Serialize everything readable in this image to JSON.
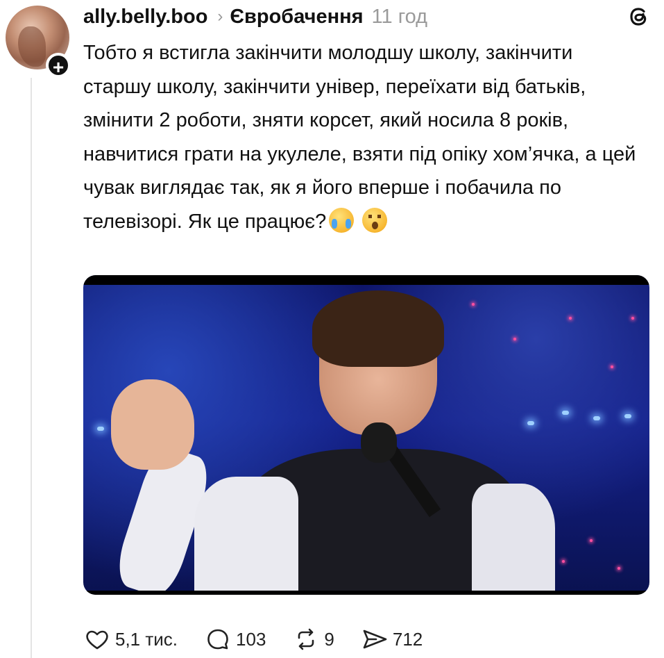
{
  "post": {
    "username": "ally.belly.boo",
    "topic": "Євробачення",
    "time": "11 год",
    "text": "Тобто я встигла закінчити молодшу школу, закінчити старшу школу, закінчити універ, переїхати від батьків, змінити 2 роботи, зняти корсет, який носила 8 років, навчитися грати на укулеле, взяти під опіку хом’ячка, а цей чувак виглядає так, як я його вперше і побачила по телевізорі. Як це працює?"
  },
  "actions": {
    "likes": "5,1 тис.",
    "replies": "103",
    "reposts": "9",
    "shares": "712"
  },
  "icons": {
    "app": "threads-logo-icon",
    "follow": "plus-icon",
    "like": "heart-icon",
    "reply": "comment-icon",
    "repost": "repost-icon",
    "share": "send-icon"
  }
}
